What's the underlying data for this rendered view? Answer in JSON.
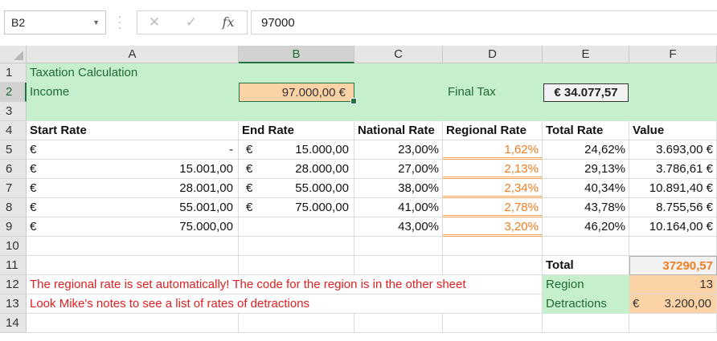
{
  "formula_bar": {
    "name_box": "B2",
    "cancel_symbol": "✕",
    "enter_symbol": "✓",
    "fx_symbol": "fx",
    "formula_value": "97000"
  },
  "columns": [
    "A",
    "B",
    "C",
    "D",
    "E",
    "F"
  ],
  "rows": [
    "1",
    "2",
    "3",
    "4",
    "5",
    "6",
    "7",
    "8",
    "9",
    "10",
    "11",
    "12",
    "13",
    "14"
  ],
  "sheet": {
    "title": "Taxation Calculation",
    "income_label": "Income",
    "income_value": "97.000,00 €",
    "final_tax_label": "Final Tax",
    "final_tax_value": "€ 34.077,57",
    "headers": {
      "start_rate": "Start Rate",
      "end_rate": "End Rate",
      "national_rate": "National Rate",
      "regional_rate": "Regional Rate",
      "total_rate": "Total Rate",
      "value": "Value"
    },
    "brackets": [
      {
        "start_cur": "€",
        "start": "-",
        "end_cur": "€",
        "end": "15.000,00",
        "national": "23,00%",
        "regional": "1,62%",
        "total": "24,62%",
        "value": "3.693,00 €"
      },
      {
        "start_cur": "€",
        "start": "15.001,00",
        "end_cur": "€",
        "end": "28.000,00",
        "national": "27,00%",
        "regional": "2,13%",
        "total": "29,13%",
        "value": "3.786,61 €"
      },
      {
        "start_cur": "€",
        "start": "28.001,00",
        "end_cur": "€",
        "end": "55.000,00",
        "national": "38,00%",
        "regional": "2,34%",
        "total": "40,34%",
        "value": "10.891,40 €"
      },
      {
        "start_cur": "€",
        "start": "55.001,00",
        "end_cur": "€",
        "end": "75.000,00",
        "national": "41,00%",
        "regional": "2,78%",
        "total": "43,78%",
        "value": "8.755,56 €"
      },
      {
        "start_cur": "€",
        "start": "75.000,00",
        "end_cur": "",
        "end": "",
        "national": "43,00%",
        "regional": "3,20%",
        "total": "46,20%",
        "value": "10.164,00 €"
      }
    ],
    "total_label": "Total",
    "total_value": "37290,57",
    "region_label": "Region",
    "region_value": "13",
    "detractions_label": "Detractions",
    "detractions_cur": "€",
    "detractions_value": "3.200,00",
    "note_1": "The regional rate is set automatically! The code for the region is in the other sheet",
    "note_2": "Look Mike's notes to see a list of rates of detractions"
  },
  "colors": {
    "green_fill": "#c6efce",
    "green_text": "#1f6b33",
    "peach_fill": "#fcd3a6",
    "orange_text": "#f07d21",
    "red_text": "#e02020",
    "selection": "#217346"
  }
}
